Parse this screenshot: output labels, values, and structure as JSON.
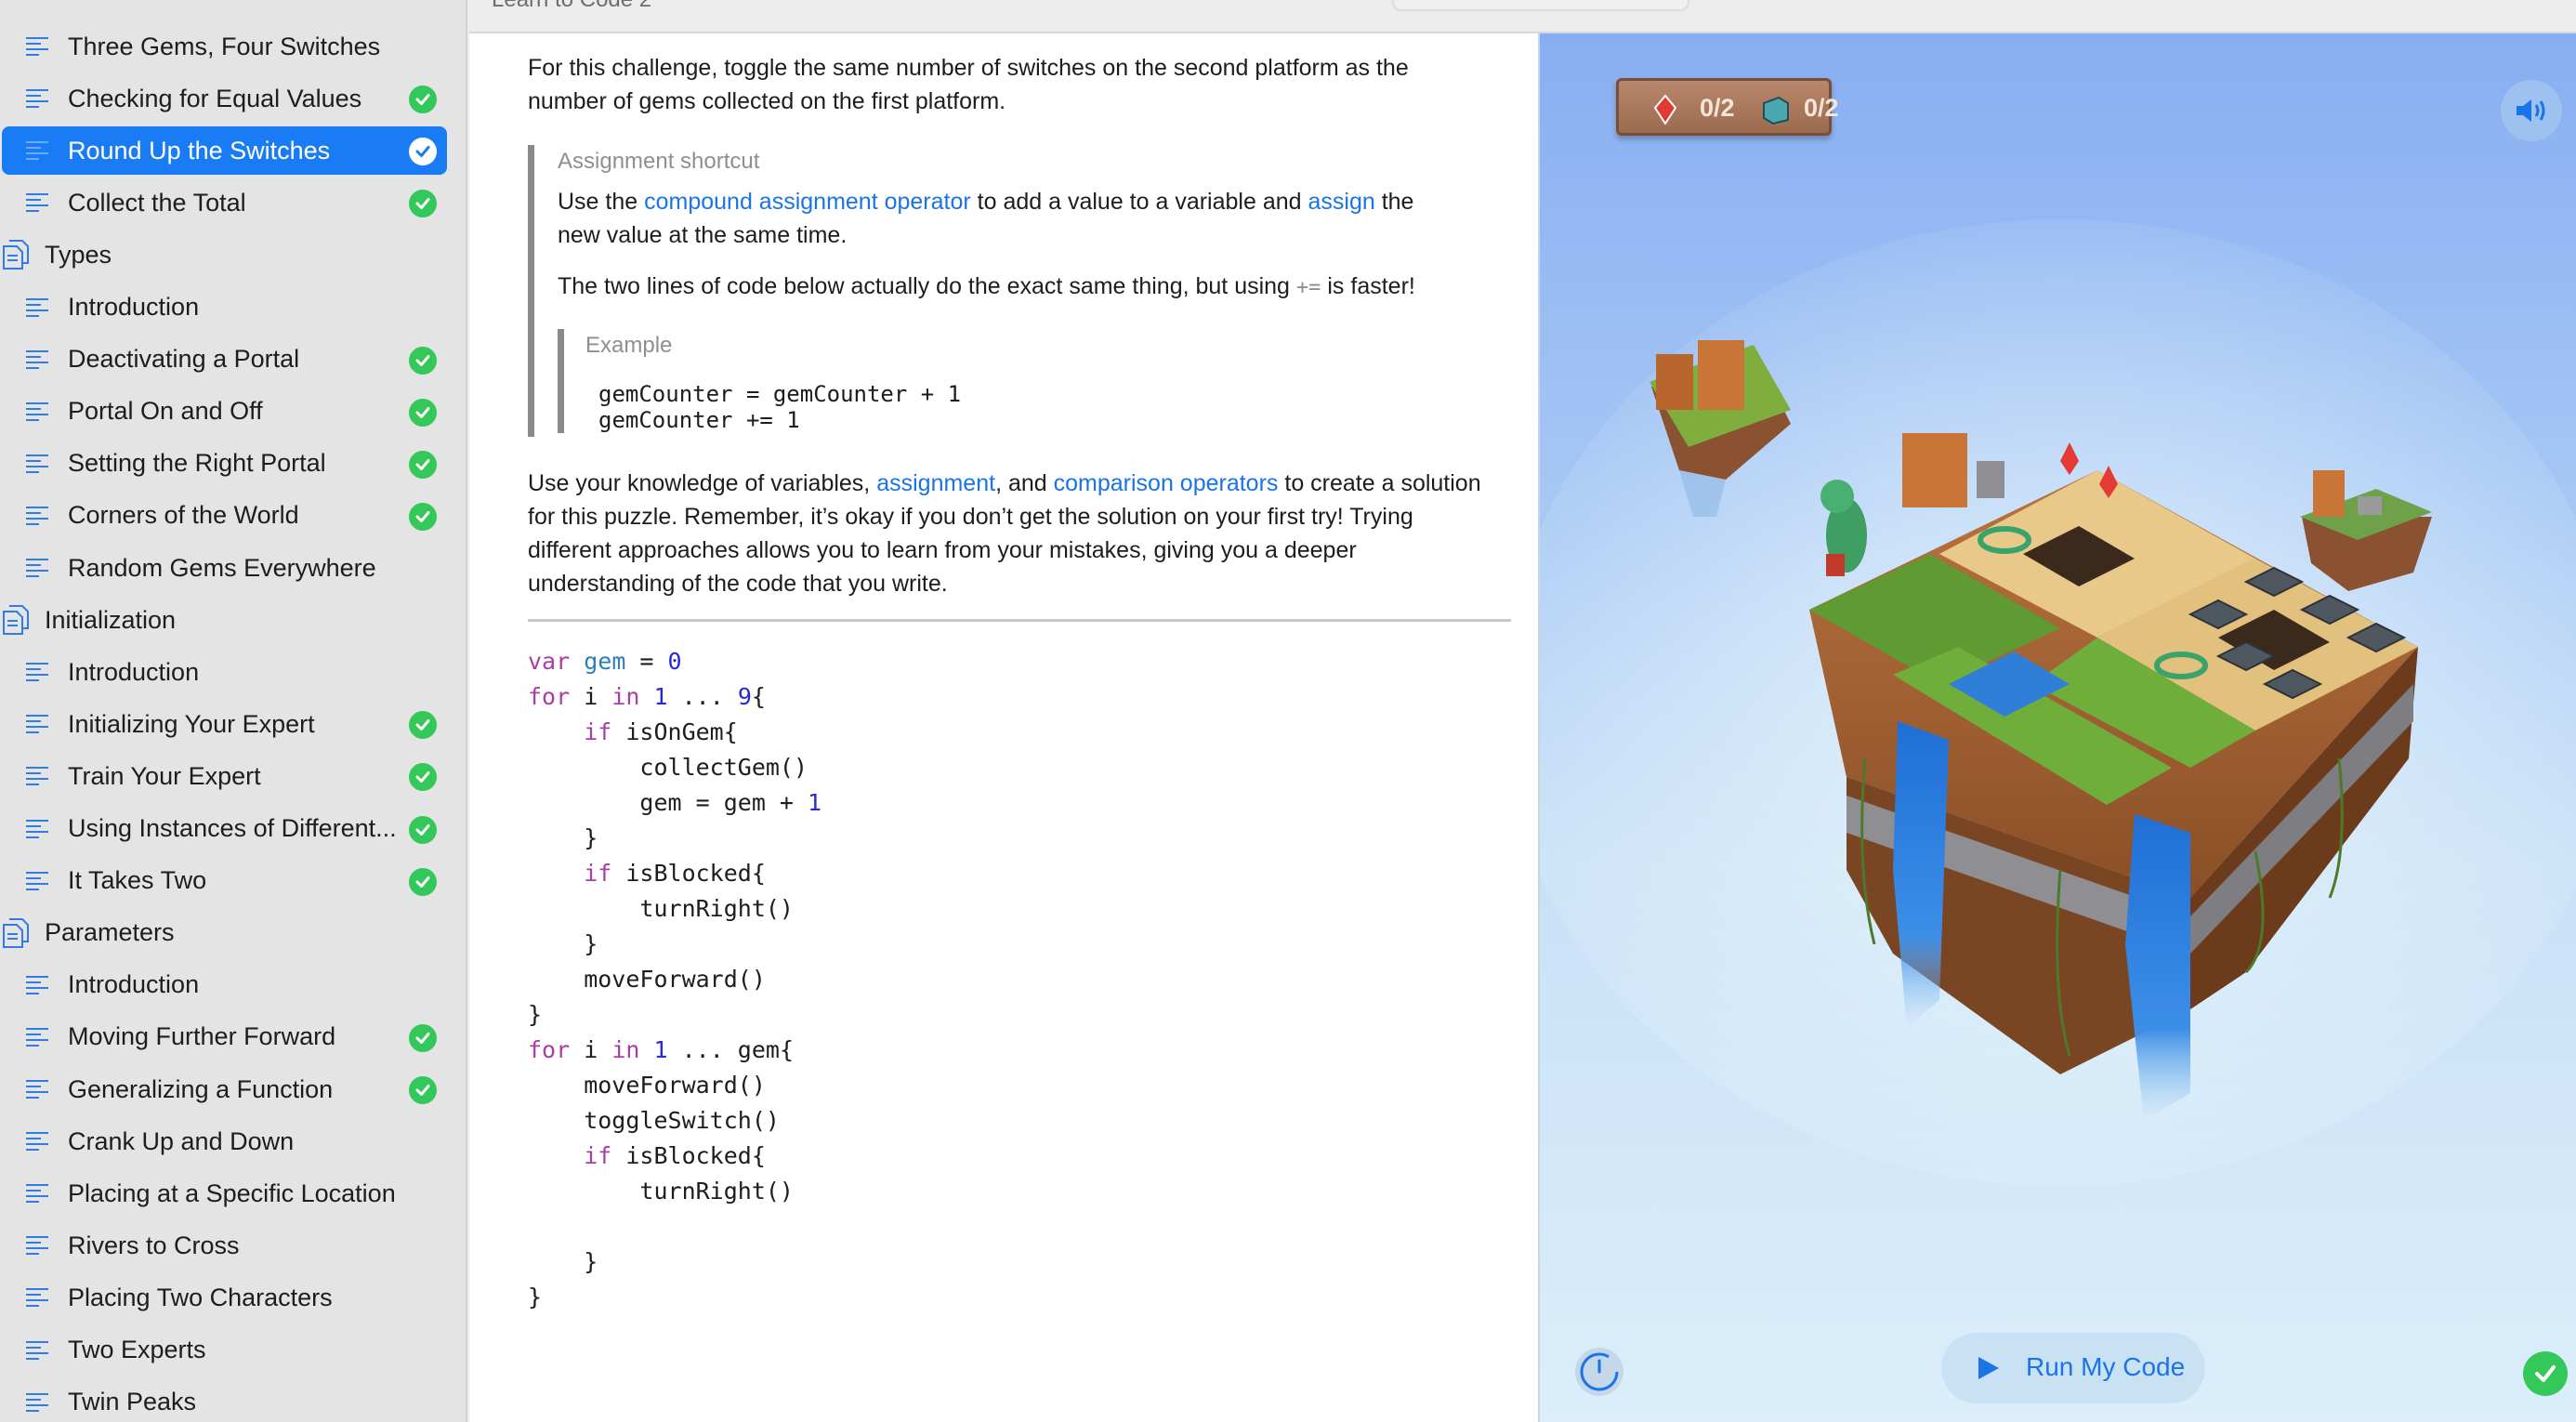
{
  "window": {
    "title": "Learn to Code 2"
  },
  "sidebar": {
    "items": [
      {
        "kind": "page",
        "label": "Three Gems, Four Switches",
        "done": false,
        "selected": false
      },
      {
        "kind": "page",
        "label": "Checking for Equal Values",
        "done": true,
        "selected": false
      },
      {
        "kind": "page",
        "label": "Round Up the Switches",
        "done": true,
        "selected": true
      },
      {
        "kind": "page",
        "label": "Collect the Total",
        "done": true,
        "selected": false
      },
      {
        "kind": "chapter",
        "label": "Types",
        "done": false,
        "selected": false
      },
      {
        "kind": "page",
        "label": "Introduction",
        "done": false,
        "selected": false
      },
      {
        "kind": "page",
        "label": "Deactivating a Portal",
        "done": true,
        "selected": false
      },
      {
        "kind": "page",
        "label": "Portal On and Off",
        "done": true,
        "selected": false
      },
      {
        "kind": "page",
        "label": "Setting the Right Portal",
        "done": true,
        "selected": false
      },
      {
        "kind": "page",
        "label": "Corners of the World",
        "done": true,
        "selected": false
      },
      {
        "kind": "page",
        "label": "Random Gems Everywhere",
        "done": false,
        "selected": false
      },
      {
        "kind": "chapter",
        "label": "Initialization",
        "done": false,
        "selected": false
      },
      {
        "kind": "page",
        "label": "Introduction",
        "done": false,
        "selected": false
      },
      {
        "kind": "page",
        "label": "Initializing Your Expert",
        "done": true,
        "selected": false
      },
      {
        "kind": "page",
        "label": "Train Your Expert",
        "done": true,
        "selected": false
      },
      {
        "kind": "page",
        "label": "Using Instances of Different...",
        "done": true,
        "selected": false
      },
      {
        "kind": "page",
        "label": "It Takes Two",
        "done": true,
        "selected": false
      },
      {
        "kind": "chapter",
        "label": "Parameters",
        "done": false,
        "selected": false
      },
      {
        "kind": "page",
        "label": "Introduction",
        "done": false,
        "selected": false
      },
      {
        "kind": "page",
        "label": "Moving Further Forward",
        "done": true,
        "selected": false
      },
      {
        "kind": "page",
        "label": "Generalizing a Function",
        "done": true,
        "selected": false
      },
      {
        "kind": "page",
        "label": "Crank Up and Down",
        "done": false,
        "selected": false
      },
      {
        "kind": "page",
        "label": "Placing at a Specific Location",
        "done": false,
        "selected": false
      },
      {
        "kind": "page",
        "label": "Rivers to Cross",
        "done": false,
        "selected": false
      },
      {
        "kind": "page",
        "label": "Placing Two Characters",
        "done": false,
        "selected": false
      },
      {
        "kind": "page",
        "label": "Two Experts",
        "done": false,
        "selected": false
      },
      {
        "kind": "page",
        "label": "Twin Peaks",
        "done": false,
        "selected": false
      }
    ]
  },
  "content": {
    "intro": "For this challenge, toggle the same number of switches on the second platform as the number of gems collected on the first platform.",
    "shortcut": {
      "heading": "Assignment shortcut",
      "p1_before": "Use the ",
      "p1_link1": "compound assignment operator",
      "p1_mid": " to add a value to a variable and ",
      "p1_link2": "assign",
      "p1_after": " the new value at the same time.",
      "p2_before": "The two lines of code below actually do the exact same thing, but using ",
      "p2_op": "+=",
      "p2_after": " is faster!",
      "example": {
        "heading": "Example",
        "code": "gemCounter = gemCounter + 1\ngemCounter += 1"
      }
    },
    "knowledge": {
      "before": "Use your knowledge of variables, ",
      "link1": "assignment",
      "mid": ", and ",
      "link2": "comparison operators",
      "after": " to create a solution for this puzzle. Remember, it’s okay if you don’t get the solution on your first try! Trying different approaches allows you to learn from your mistakes, giving you a deeper understanding of the code that you write."
    },
    "code_lines": [
      [
        {
          "t": "var",
          "c": "kw"
        },
        {
          "t": " "
        },
        {
          "t": "gem",
          "c": "var"
        },
        {
          "t": " = "
        },
        {
          "t": "0",
          "c": "num"
        }
      ],
      [
        {
          "t": "for",
          "c": "kw"
        },
        {
          "t": " i "
        },
        {
          "t": "in",
          "c": "kw"
        },
        {
          "t": " "
        },
        {
          "t": "1",
          "c": "num"
        },
        {
          "t": " ... "
        },
        {
          "t": "9",
          "c": "num"
        },
        {
          "t": "{"
        }
      ],
      [
        {
          "t": "    "
        },
        {
          "t": "if",
          "c": "kw"
        },
        {
          "t": " isOnGem{"
        }
      ],
      [
        {
          "t": "        collectGem()"
        }
      ],
      [
        {
          "t": "        gem = gem + "
        },
        {
          "t": "1",
          "c": "num"
        }
      ],
      [
        {
          "t": "    }"
        }
      ],
      [
        {
          "t": "    "
        },
        {
          "t": "if",
          "c": "kw"
        },
        {
          "t": " isBlocked{"
        }
      ],
      [
        {
          "t": "        turnRight()"
        }
      ],
      [
        {
          "t": "    }"
        }
      ],
      [
        {
          "t": "    moveForward()"
        }
      ],
      [
        {
          "t": "}"
        }
      ],
      [
        {
          "t": "for",
          "c": "kw"
        },
        {
          "t": " i "
        },
        {
          "t": "in",
          "c": "kw"
        },
        {
          "t": " "
        },
        {
          "t": "1",
          "c": "num"
        },
        {
          "t": " ... gem{"
        }
      ],
      [
        {
          "t": "    moveForward()"
        }
      ],
      [
        {
          "t": "    toggleSwitch()"
        }
      ],
      [
        {
          "t": "    "
        },
        {
          "t": "if",
          "c": "kw"
        },
        {
          "t": " isBlocked{"
        }
      ],
      [
        {
          "t": "        turnRight()"
        }
      ],
      [
        {
          "t": ""
        }
      ],
      [
        {
          "t": "    }"
        }
      ],
      [
        {
          "t": "}"
        }
      ]
    ]
  },
  "scene": {
    "gems": "0/2",
    "switches": "0/2",
    "run_label": "Run My Code"
  },
  "colors": {
    "accent": "#1a7cf5",
    "check": "#34c759",
    "link": "#1a73e8",
    "keyword": "#ad3da4",
    "number": "#272ad8"
  }
}
